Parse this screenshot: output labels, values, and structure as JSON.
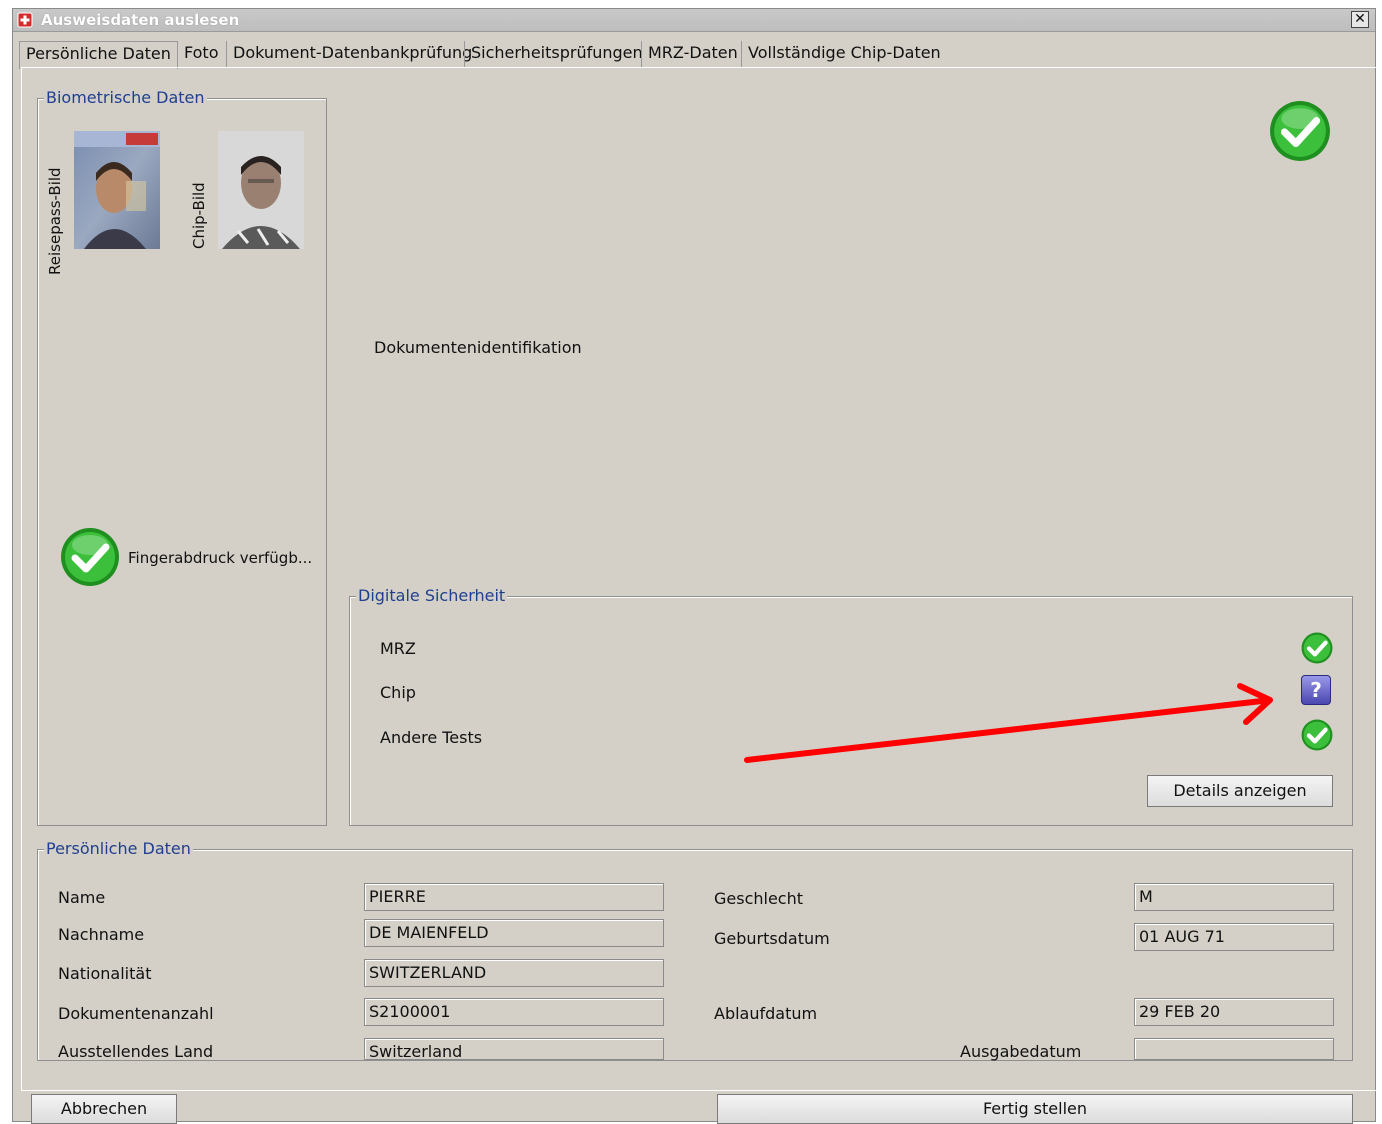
{
  "window": {
    "title": "Ausweisdaten auslesen",
    "close_symbol": "✕"
  },
  "tabs": [
    {
      "label": "Persönliche Daten",
      "active": true
    },
    {
      "label": "Foto"
    },
    {
      "label": "Dokument-Datenbankprüfung"
    },
    {
      "label": "Sicherheitsprüfungen"
    },
    {
      "label": "MRZ-Daten"
    },
    {
      "label": "Vollständige Chip-Daten"
    }
  ],
  "biometric": {
    "title": "Biometrische Daten",
    "passport_photo_label": "Reisepass-Bild",
    "chip_photo_label": "Chip-Bild",
    "fingerprint_label": "Fingerabdruck verfügb...",
    "fingerprint_status": "ok"
  },
  "document": {
    "identification_label": "Dokumentenidentifikation",
    "overall_status": "ok"
  },
  "digital_security": {
    "title": "Digitale Sicherheit",
    "items": [
      {
        "label": "MRZ",
        "status": "ok"
      },
      {
        "label": "Chip",
        "status": "unknown",
        "status_symbol": "?"
      },
      {
        "label": "Andere Tests",
        "status": "ok"
      }
    ],
    "details_button": "Details anzeigen",
    "arrow_color": "#ff0000"
  },
  "personal": {
    "title": "Persönliche Daten",
    "name_label": "Name",
    "name_value": "PIERRE",
    "surname_label": "Nachname",
    "surname_value": "DE MAIENFELD",
    "nationality_label": "Nationalität",
    "nationality_value": "SWITZERLAND",
    "doc_number_label": "Dokumentenanzahl",
    "doc_number_value": "S2100001",
    "issuing_country_label": "Ausstellendes Land",
    "issuing_country_value": "Switzerland",
    "sex_label": "Geschlecht",
    "sex_value": "M",
    "birth_label": "Geburtsdatum",
    "birth_value": "01 AUG 71",
    "expiry_label": "Ablaufdatum",
    "expiry_value": "29 FEB 20",
    "issue_label": "Ausgabedatum",
    "issue_value": ""
  },
  "footer": {
    "cancel": "Abbrechen",
    "finish": "Fertig stellen"
  },
  "colors": {
    "window_bg": "#d4d0c8",
    "group_title": "#1f3f8f",
    "check_green": "#2aa02a"
  },
  "icons": [
    "app-shield-icon",
    "close-icon",
    "check-icon",
    "question-icon",
    "red-arrow-annotation"
  ]
}
